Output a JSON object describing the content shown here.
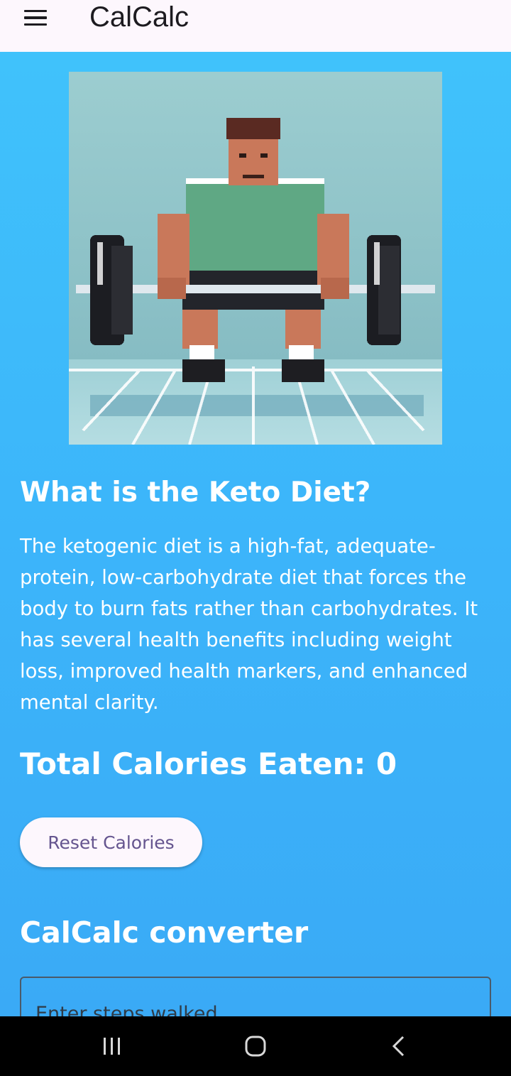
{
  "appbar": {
    "title": "CalCalc",
    "menu_icon": "hamburger-menu-icon"
  },
  "hero": {
    "image": "pixel-art-weightlifter-deadlift"
  },
  "keto": {
    "heading": "What is the Keto Diet?",
    "description": "The ketogenic diet is a high-fat, adequate-protein, low-carbohydrate diet that forces the body to burn fats rather than carbohydrates. It has several health benefits including weight loss, improved health markers, and enhanced mental clarity."
  },
  "calories": {
    "total_text": "Total Calories Eaten: 0",
    "reset_label": "Reset Calories"
  },
  "converter": {
    "heading": "CalCalc converter",
    "steps_placeholder": "Enter steps walked"
  },
  "system_nav": {
    "recents_icon": "recent-apps-icon",
    "home_icon": "home-icon",
    "back_icon": "back-icon"
  },
  "colors": {
    "background": "#3db4f9",
    "appbar": "#fdf7fd",
    "button_text": "#65558f",
    "nav_bar": "#000000"
  }
}
